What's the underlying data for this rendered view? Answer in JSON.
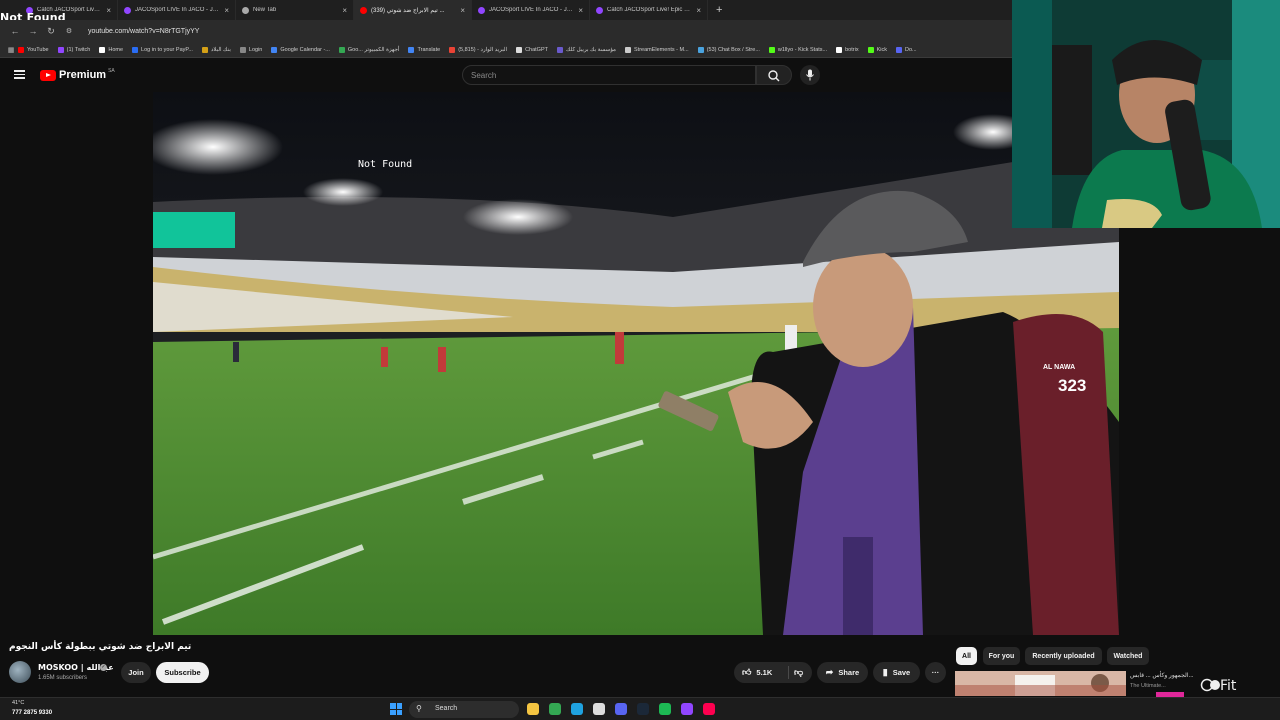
{
  "corner_overlay_text": "Not Found",
  "browser": {
    "tabs": [
      {
        "title": "Catch JACOSport Live! Epic Sp...",
        "color": "#9146ff",
        "active": false
      },
      {
        "title": "JACOSport LIVE In JACO - JACO",
        "color": "#9146ff",
        "active": false
      },
      {
        "title": "New Tab",
        "color": "#aaaaaa",
        "active": false
      },
      {
        "title": "تيم الابراج ضد شوتي (339) ...",
        "color": "#ff0000",
        "active": true
      },
      {
        "title": "JACOSport LIVE In JACO - JACO",
        "color": "#9146ff",
        "active": false
      },
      {
        "title": "Catch JACOSport Live! Epic Sp...",
        "color": "#9146ff",
        "active": false
      }
    ],
    "new_tab_glyph": "+",
    "url": "youtube.com/watch?v=N8rTGTjyYY",
    "bookmarks": [
      {
        "label": "YouTube",
        "color": "#ff0000"
      },
      {
        "label": "(1) Twitch",
        "color": "#9146ff"
      },
      {
        "label": "Home",
        "color": "#ffffff"
      },
      {
        "label": "Log in to your PayP...",
        "color": "#2a6df4"
      },
      {
        "label": "بنك البلاد",
        "color": "#d4a017"
      },
      {
        "label": "Login",
        "color": "#888888"
      },
      {
        "label": "Google Calendar -...",
        "color": "#4285f4"
      },
      {
        "label": "Goo... أجهزة الكمبيوتر",
        "color": "#34a853"
      },
      {
        "label": "Translate",
        "color": "#4285f4"
      },
      {
        "label": "(5,815) - البريد الوارد",
        "color": "#ea4335"
      },
      {
        "label": "ChatGPT",
        "color": "#dddddd"
      },
      {
        "label": "مؤسسة بك بريبل كلك",
        "color": "#6a5acd"
      },
      {
        "label": "StreamElements - M...",
        "color": "#cccccc"
      },
      {
        "label": "(53) Chat Box / Stre...",
        "color": "#4aa3df"
      },
      {
        "label": "w1llyo - Kick Stats...",
        "color": "#53fc18"
      },
      {
        "label": "botrix",
        "color": "#ffffff"
      },
      {
        "label": "Kick",
        "color": "#53fc18"
      },
      {
        "label": "Do...",
        "color": "#5865f2"
      }
    ]
  },
  "youtube": {
    "brand": "Premium",
    "country": "SA",
    "search_placeholder": "Search",
    "video_overlay_text": "Not Found",
    "video_title": "تيم الابراج ضد شوتي ببطولة كأس النجوم",
    "channel_name": "MOSKOO | عبدالله",
    "subscribers": "1.65M subscribers",
    "join_label": "Join",
    "subscribe_label": "Subscribe",
    "likes": "5.1K",
    "share_label": "Share",
    "save_label": "Save",
    "more_glyph": "···",
    "chips": [
      {
        "label": "All",
        "active": true
      },
      {
        "label": "For you",
        "active": false
      },
      {
        "label": "Recently uploaded",
        "active": false
      },
      {
        "label": "Watched",
        "active": false
      }
    ],
    "rec_title": "الجمهور وكأس ... قابس...",
    "rec_channel": "The Ultimate...",
    "rec_logo_text": "Fit",
    "jersey_number": "323",
    "jersey_team": "AL NAWA"
  },
  "taskbar": {
    "weather": "41°C",
    "stats": "777  2875  9330",
    "search_label": "Search",
    "icons": [
      {
        "name": "file-explorer-icon",
        "color": "#f4c542"
      },
      {
        "name": "chrome-icon",
        "color": "#34a853"
      },
      {
        "name": "edge-icon",
        "color": "#1fa2e0"
      },
      {
        "name": "obs-icon",
        "color": "#dddddd"
      },
      {
        "name": "discord-icon",
        "color": "#5865f2"
      },
      {
        "name": "steam-icon",
        "color": "#1b2838"
      },
      {
        "name": "spotify-icon",
        "color": "#1db954"
      },
      {
        "name": "twitch-icon",
        "color": "#9146ff"
      },
      {
        "name": "tiktok-icon",
        "color": "#ff0050"
      }
    ]
  }
}
